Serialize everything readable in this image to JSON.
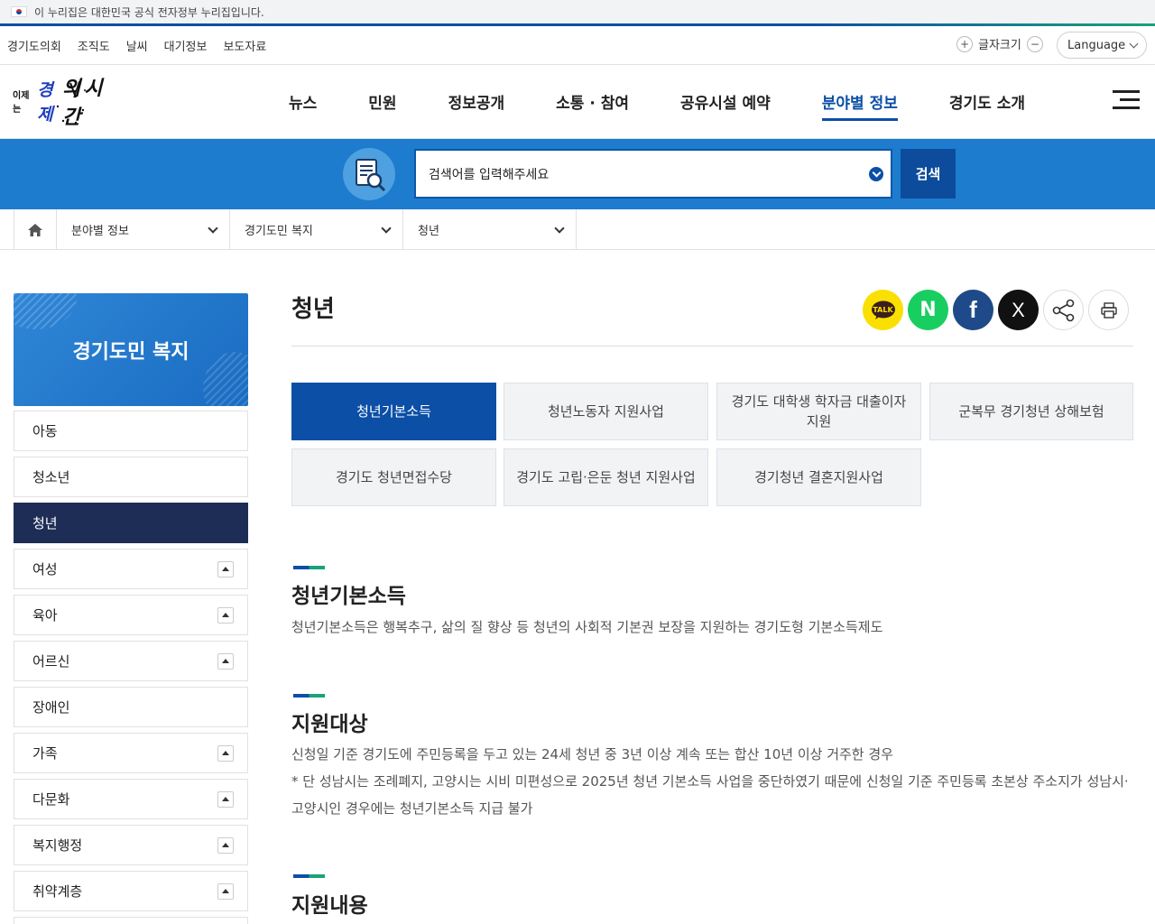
{
  "gov_banner": {
    "text": "이 누리집은 대한민국 공식 전자정부 누리집입니다."
  },
  "util": {
    "links": [
      "경기도의회",
      "조직도",
      "날씨",
      "대기정보",
      "보도자료"
    ],
    "font_size_label": "글자크기",
    "plus": "+",
    "minus": "−",
    "language_label": "Language"
  },
  "logo": {
    "small": "이제는",
    "em": "경제",
    "main": "의 시간"
  },
  "gnb": {
    "items": [
      "뉴스",
      "민원",
      "정보공개",
      "소통 · 참여",
      "공유시설 예약",
      "분야별 정보",
      "경기도 소개"
    ],
    "active_index": 5
  },
  "search": {
    "placeholder": "검색어를 입력해주세요",
    "button": "검색"
  },
  "breadcrumb": {
    "levels": [
      "분야별 정보",
      "경기도민 복지",
      "청년"
    ]
  },
  "sidebar": {
    "title": "경기도민 복지",
    "items": [
      {
        "label": "아동",
        "expandable": false
      },
      {
        "label": "청소년",
        "expandable": false
      },
      {
        "label": "청년",
        "expandable": false,
        "active": true
      },
      {
        "label": "여성",
        "expandable": true
      },
      {
        "label": "육아",
        "expandable": true
      },
      {
        "label": "어르신",
        "expandable": true
      },
      {
        "label": "장애인",
        "expandable": false
      },
      {
        "label": "가족",
        "expandable": true
      },
      {
        "label": "다문화",
        "expandable": true
      },
      {
        "label": "복지행정",
        "expandable": true
      },
      {
        "label": "취약계층",
        "expandable": true
      }
    ]
  },
  "content": {
    "title": "청년",
    "share": {
      "kakao_label": "TALK",
      "naver_label": "N",
      "facebook_label": "f",
      "x_label": "X"
    },
    "tabs": [
      "청년기본소득",
      "청년노동자 지원사업",
      "경기도 대학생 학자금 대출이자 지원",
      "군복무 경기청년 상해보험",
      "경기도 청년면접수당",
      "경기도 고립·은둔 청년 지원사업",
      "경기청년 결혼지원사업"
    ],
    "active_tab": 0,
    "sections": [
      {
        "title": "청년기본소득",
        "lines": [
          "청년기본소득은 행복추구, 삶의 질 향상 등 청년의 사회적 기본권 보장을 지원하는 경기도형 기본소득제도"
        ]
      },
      {
        "title": "지원대상",
        "lines": [
          "신청일 기준 경기도에 주민등록을 두고 있는 24세 청년 중 3년 이상 계속 또는 합산 10년 이상 거주한 경우",
          "* 단 성남시는 조례폐지, 고양시는 시비 미편성으로 2025년 청년 기본소득 사업을 중단하였기 때문에 신청일 기준 주민등록 초본상 주소지가 성남시·",
          "고양시인 경우에는 청년기본소득 지급 불가"
        ]
      },
      {
        "title": "지원내용",
        "lines": []
      }
    ]
  },
  "colors": {
    "primary": "#0b4fa6",
    "search_band": "#1d7ccd",
    "side_active": "#1e2d55",
    "accent_green": "#18a37b"
  }
}
